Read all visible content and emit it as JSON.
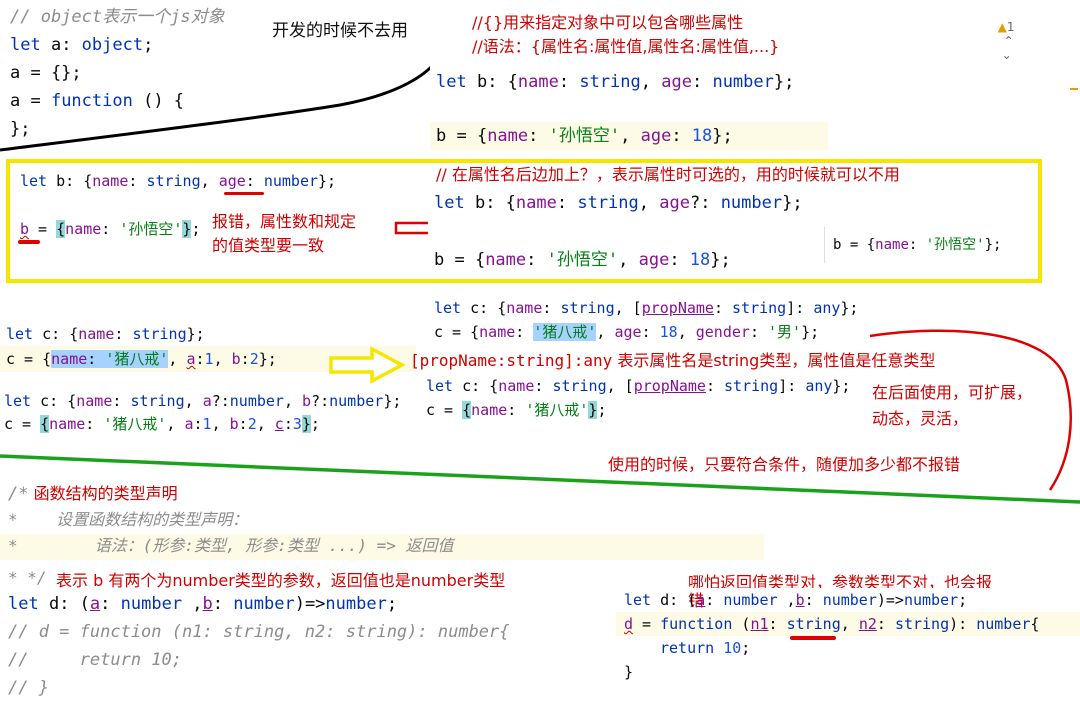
{
  "colors": {
    "keyword": "#0033b3",
    "property": "#871094",
    "string": "#067d17",
    "number": "#1750eb",
    "comment": "#8c8c8c",
    "annotation_red": "#d00000",
    "yellow_frame": "#f5e600",
    "green_line": "#1aa31a"
  },
  "icons": [
    "warning-icon",
    "chevron-up-icon",
    "chevron-down-icon",
    "right-arrow-red-icon",
    "right-arrow-yellow-icon"
  ],
  "top_left": {
    "l1": "// object表示一个js对象",
    "l2_kw": "let",
    "l2_rest": " a: ",
    "l2_type": "object",
    "l2_end": ";",
    "l3": "a = {};",
    "l4_a": "a = ",
    "l4_kw": "function",
    "l4_rest": " () {",
    "l5": "};",
    "note": "开发的时候不去用"
  },
  "top_right": {
    "warn_count": "1",
    "c1": "//{}用来指定对象中可以包含哪些属性",
    "c2": "//语法：{属性名:属性值,属性名:属性值,...}",
    "l1_kw": "let",
    "l1_a": " b: {",
    "l1_p1": "name",
    "l1_b": ": ",
    "l1_t1": "string",
    "l1_c": ", ",
    "l1_p2": "age",
    "l1_d": ": ",
    "l1_t2": "number",
    "l1_e": "};",
    "l2_a": "b = {",
    "l2_p1": "name",
    "l2_b": ": ",
    "l2_s": "'孙悟空'",
    "l2_c": ", ",
    "l2_p2": "age",
    "l2_d": ": ",
    "l2_n": "18",
    "l2_e": "};"
  },
  "yellow_left": {
    "l1_kw": "let",
    "l1_a": " b: {",
    "l1_p1": "name",
    "l1_b": ": ",
    "l1_t1": "string",
    "l1_c": ", ",
    "l1_p2": "age",
    "l1_d": ": ",
    "l1_t2": "number",
    "l1_e": "};",
    "l2_a": "b",
    "l2_b": " = ",
    "l2_br": "{",
    "l2_p1": "name",
    "l2_c": ": ",
    "l2_s": "'孙悟空'",
    "l2_br2": "}",
    "l2_e": ";",
    "note1": "报错，属性数和规定",
    "note2": "的值类型要一致"
  },
  "yellow_right": {
    "c1": "// 在属性名后边加上？，表示属性时可选的，用的时候就可以不用",
    "l1_kw": "let",
    "l1_a": " b: {",
    "l1_p1": "name",
    "l1_b": ": ",
    "l1_t1": "string",
    "l1_c": ", ",
    "l1_p2": "age",
    "l1_d": "?: ",
    "l1_t2": "number",
    "l1_e": "};",
    "l2_a": "b = {",
    "l2_p1": "name",
    "l2_b": ": ",
    "l2_s": "'孙悟空'",
    "l2_c": ", ",
    "l2_p2": "age",
    "l2_d": ": ",
    "l2_n": "18",
    "l2_e": "};",
    "popup_a": "b = {",
    "popup_p": "name",
    "popup_b": ": ",
    "popup_s": "'孙悟空'",
    "popup_e": "};"
  },
  "mid_left": {
    "l1_kw": "let",
    "l1_a": " c: {",
    "l1_p": "name",
    "l1_b": ": ",
    "l1_t": "string",
    "l1_e": "};",
    "l2_a": "c = {",
    "l2_p": "name",
    "l2_b": ": ",
    "l2_s": "'猪八戒'",
    "l2_c": ", ",
    "l2_p2": "a",
    "l2_d": ":",
    "l2_n1": "1",
    "l2_e": ", ",
    "l2_p3": "b",
    "l2_f": ":",
    "l2_n2": "2",
    "l2_g": "};",
    "l3_kw": "let",
    "l3_a": " c: {",
    "l3_p1": "name",
    "l3_b": ": ",
    "l3_t1": "string",
    "l3_c": ", ",
    "l3_p2": "a",
    "l3_d": "?:",
    "l3_t2": "number",
    "l3_e": ", ",
    "l3_p3": "b",
    "l3_f": "?:",
    "l3_t3": "number",
    "l3_g": "};",
    "l4_a": "c = ",
    "l4_br": "{",
    "l4_p1": "name",
    "l4_b": ": ",
    "l4_s": "'猪八戒'",
    "l4_c": ", ",
    "l4_p2": "a",
    "l4_d": ":",
    "l4_n1": "1",
    "l4_e": ", ",
    "l4_p3": "b",
    "l4_f": ":",
    "l4_n2": "2",
    "l4_g": ", ",
    "l4_p4": "c",
    "l4_h": ":",
    "l4_n3": "3",
    "l4_br2": "}",
    "l4_i": ";"
  },
  "mid_right": {
    "l1_kw": "let",
    "l1_a": " c: {",
    "l1_p": "name",
    "l1_b": ": ",
    "l1_t1": "string",
    "l1_c": ", [",
    "l1_pn": "propName",
    "l1_d": ": ",
    "l1_t2": "string",
    "l1_e": "]: ",
    "l1_t3": "any",
    "l1_f": "};",
    "l2_a": "c = {",
    "l2_p": "name",
    "l2_b": ": ",
    "l2_s": "'猪八戒'",
    "l2_c": ", ",
    "l2_p2": "age",
    "l2_d": ": ",
    "l2_n": "18",
    "l2_e": ", ",
    "l2_p3": "gender",
    "l2_f": ": ",
    "l2_s2": "'男'",
    "l2_g": "};",
    "desc_code": "[propName:string]:any",
    "desc_text": " 表示属性名是string类型，属性值是任意类型",
    "l3_kw": "let",
    "l3_a": " c: {",
    "l3_p": "name",
    "l3_b": ": ",
    "l3_t1": "string",
    "l3_c": ", [",
    "l3_pn": "propName",
    "l3_d": ": ",
    "l3_t2": "string",
    "l3_e": "]: ",
    "l3_t3": "any",
    "l3_f": "};",
    "l4_a": "c = ",
    "l4_br": "{",
    "l4_p": "name",
    "l4_b": ": ",
    "l4_s": "'猪八戒'",
    "l4_br2": "}",
    "l4_e": ";",
    "note1": "在后面使用，可扩展，",
    "note2": "动态，灵活，",
    "note3": "使用的时候，只要符合条件，随便加多少都不报错"
  },
  "bottom_left": {
    "c1a": "/*",
    "c1b": " 函数结构的类型声明",
    "c2": "*    设置函数结构的类型声明：",
    "c3": "*        语法：(形参:类型, 形参:类型 ...) => 返回值",
    "c4": "* */",
    "note": "表示 b 有两个为number类型的参数，返回值也是number类型",
    "l1_kw": "let",
    "l1_a": " d: (",
    "l1_p1": "a",
    "l1_b": ": ",
    "l1_t1": "number",
    "l1_c": " ,",
    "l1_p2": "b",
    "l1_d": ": ",
    "l1_t2": "number",
    "l1_e": ")=>",
    "l1_t3": "number",
    "l1_f": ";",
    "c5": "// d = function (n1: string, n2: string): number{",
    "c6": "//     return 10;",
    "c7": "// }"
  },
  "bottom_right": {
    "note1": "哪怕返回值类型对，参数类型不对，也会报",
    "note2": "错",
    "l1_kw": "let",
    "l1_a": " d: (",
    "l1_p1": "a",
    "l1_b": ": ",
    "l1_t1": "number",
    "l1_c": " ,",
    "l1_p2": "b",
    "l1_d": ": ",
    "l1_t2": "number",
    "l1_e": ")=>",
    "l1_t3": "number",
    "l1_f": ";",
    "l2_a": "d",
    "l2_b": " = ",
    "l2_kw": "function",
    "l2_c": " (",
    "l2_p1": "n1",
    "l2_d": ": ",
    "l2_t1": "string",
    "l2_e": ", ",
    "l2_p2": "n2",
    "l2_f": ": ",
    "l2_t2": "string",
    "l2_g": "): ",
    "l2_t3": "number",
    "l2_h": "{",
    "l3_kw": "return",
    "l3_n": "10",
    "l3_e": ";",
    "l4": "}"
  }
}
